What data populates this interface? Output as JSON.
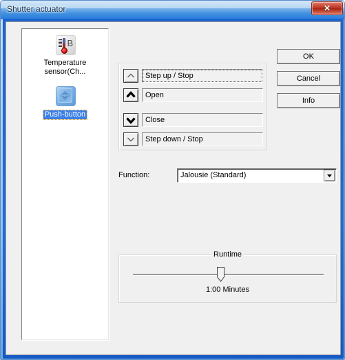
{
  "window": {
    "title": "Shutter actuator",
    "close_label": "✕",
    "close_icon": "close-icon"
  },
  "device_list": {
    "items": [
      {
        "label": "Temperature sensor(Ch...",
        "icon": "temperature-sensor-icon",
        "icon_letter": "B",
        "selected": false
      },
      {
        "label": "Push-button",
        "icon": "push-button-icon",
        "selected": true
      }
    ]
  },
  "buttons": {
    "ok": "OK",
    "cancel": "Cancel",
    "info": "Info"
  },
  "commands": {
    "rows": [
      {
        "label": "Step up / Stop",
        "icon": "chevron-up-thin-icon",
        "focused": true
      },
      {
        "label": "Open",
        "icon": "chevron-up-bold-icon",
        "focused": false
      },
      {
        "label": "Close",
        "icon": "chevron-down-bold-icon",
        "focused": false
      },
      {
        "label": "Step down / Stop",
        "icon": "chevron-down-thin-icon",
        "focused": false
      }
    ]
  },
  "function": {
    "label": "Function:",
    "value": "Jalousie (Standard)",
    "dropdown_icon": "chevron-down-icon"
  },
  "runtime": {
    "legend": "Runtime",
    "value": "1:00 Minutes",
    "slider_percent": 50
  },
  "colors": {
    "accent_blue": "#1f6ad8",
    "selection_blue": "#3a7ee8",
    "close_red": "#bb3422",
    "dialog_face": "#f0f0f0"
  }
}
